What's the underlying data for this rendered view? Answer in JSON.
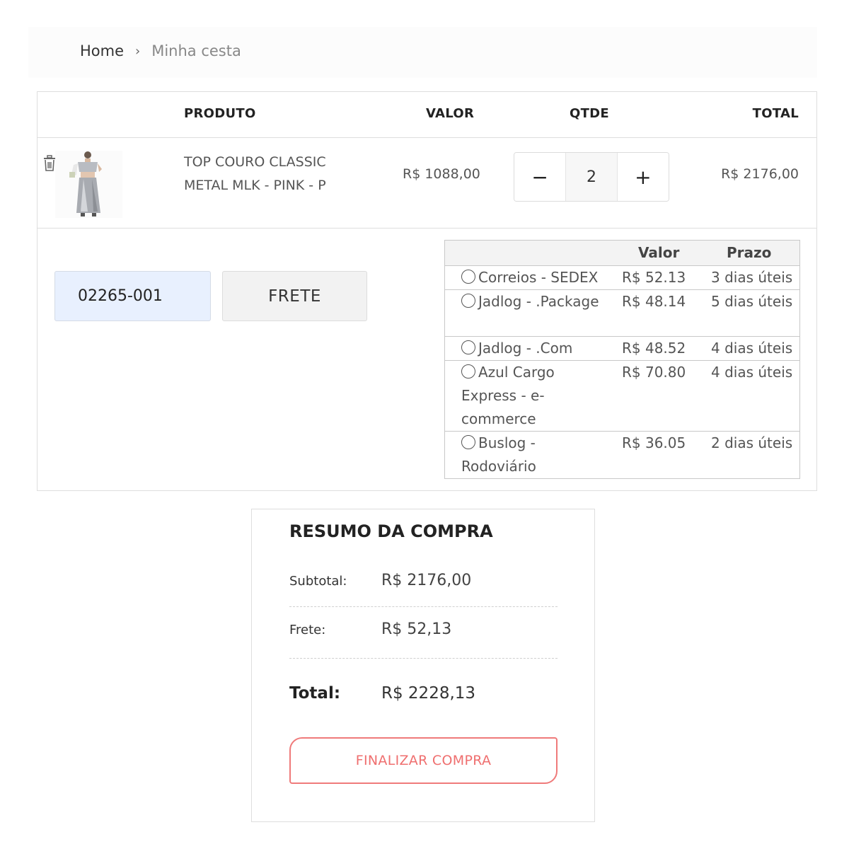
{
  "breadcrumb": {
    "home": "Home",
    "separator": "›",
    "current": "Minha cesta"
  },
  "cart": {
    "headers": {
      "produto": "PRODUTO",
      "valor": "VALOR",
      "qtde": "QTDE",
      "total": "TOTAL"
    },
    "item": {
      "name": "TOP COURO CLASSIC METAL MLK - PINK - P",
      "price": "R$ 1088,00",
      "quantity": "2",
      "decrement": "−",
      "increment": "+",
      "total": "R$ 2176,00"
    }
  },
  "shipping": {
    "cep_value": "02265-001",
    "button_label": "FRETE",
    "table_headers": {
      "valor": "Valor",
      "prazo": "Prazo"
    },
    "options": [
      {
        "name": "Correios - SEDEX",
        "value": "R$ 52.13",
        "prazo": "3 dias úteis"
      },
      {
        "name": "Jadlog - .Package",
        "value": "R$ 48.14",
        "prazo": "5 dias úteis"
      },
      {
        "name": "Jadlog - .Com",
        "value": "R$ 48.52",
        "prazo": "4 dias úteis"
      },
      {
        "name": "Azul Cargo Express - e-commerce",
        "value": "R$ 70.80",
        "prazo": "4 dias úteis"
      },
      {
        "name": "Buslog - Rodoviário",
        "value": "R$ 36.05",
        "prazo": "2 dias úteis"
      }
    ]
  },
  "summary": {
    "title": "RESUMO DA COMPRA",
    "subtotal_label": "Subtotal:",
    "subtotal_value": "R$ 2176,00",
    "frete_label": "Frete:",
    "frete_value": "R$ 52,13",
    "total_label": "Total:",
    "total_value": "R$ 2228,13",
    "checkout_label": "FINALIZAR COMPRA"
  },
  "colors": {
    "accent": "#ef6f6f",
    "cep_bg": "#e8f0fe"
  },
  "icons": {
    "remove": "trash-icon",
    "breadcrumb_separator": "chevron-right-icon"
  }
}
